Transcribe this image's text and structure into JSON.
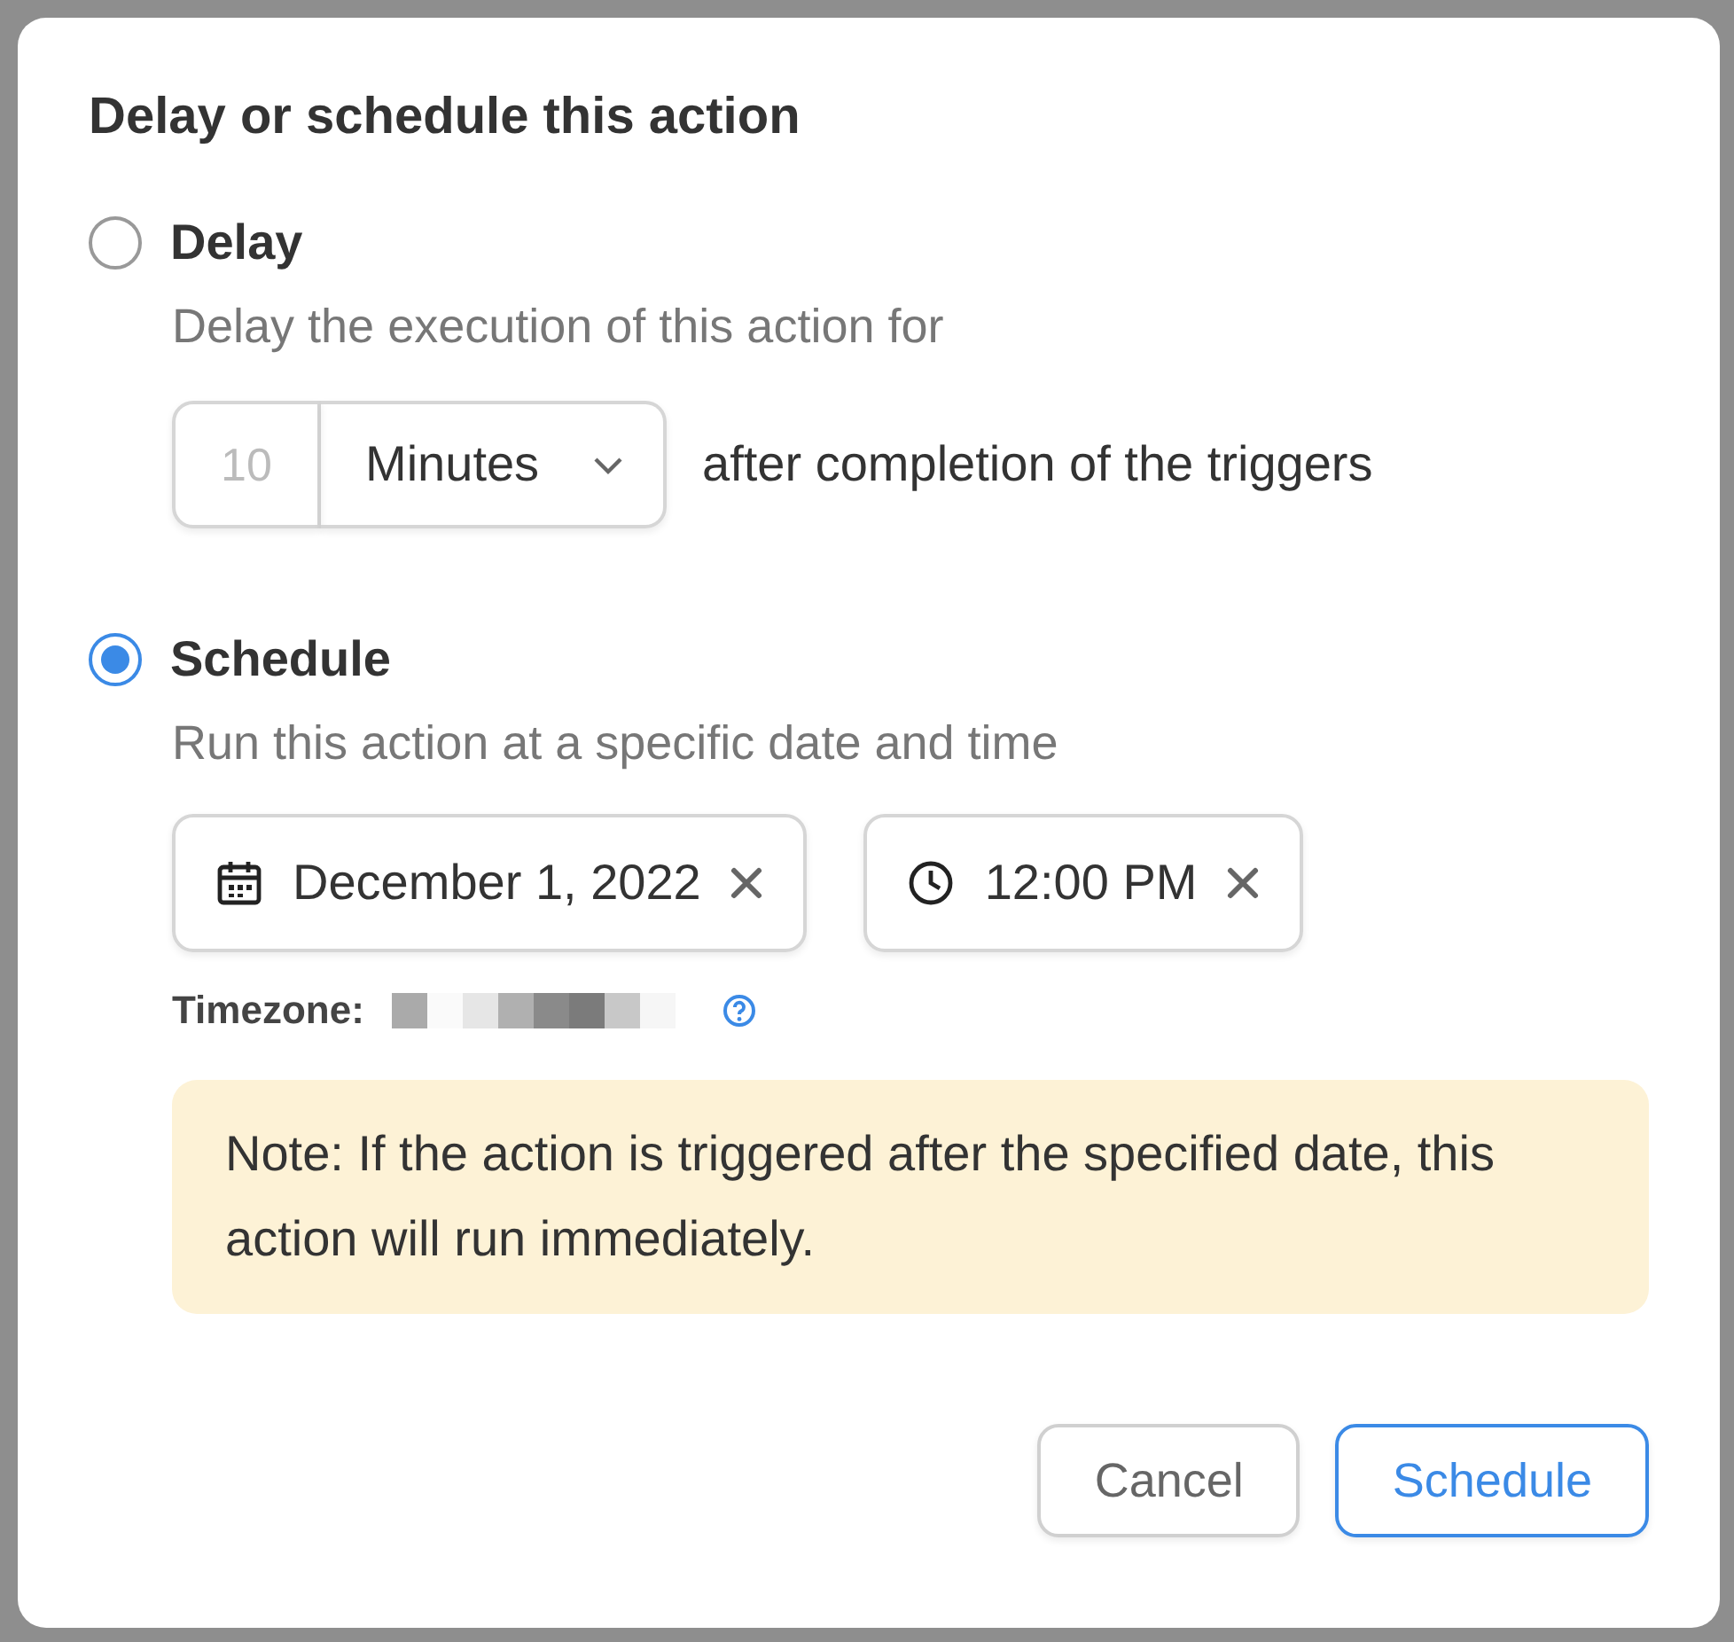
{
  "dialog": {
    "title": "Delay or schedule this action",
    "options": [
      {
        "kind": "delay",
        "label": "Delay",
        "selected": false,
        "description": "Delay the execution of this action for",
        "amount": {
          "placeholder": "10"
        },
        "unit": "Minutes",
        "suffix": "after completion of the triggers"
      },
      {
        "kind": "schedule",
        "label": "Schedule",
        "selected": true,
        "description": "Run this action at a specific date and time",
        "date": "December 1, 2022",
        "time": "12:00 PM",
        "timezone_label": "Timezone:"
      }
    ],
    "note": "Note: If the action is triggered after the specified date, this action will run immediately.",
    "buttons": [
      {
        "label": "Cancel",
        "kind": "secondary"
      },
      {
        "label": "Schedule",
        "kind": "primary"
      }
    ]
  }
}
